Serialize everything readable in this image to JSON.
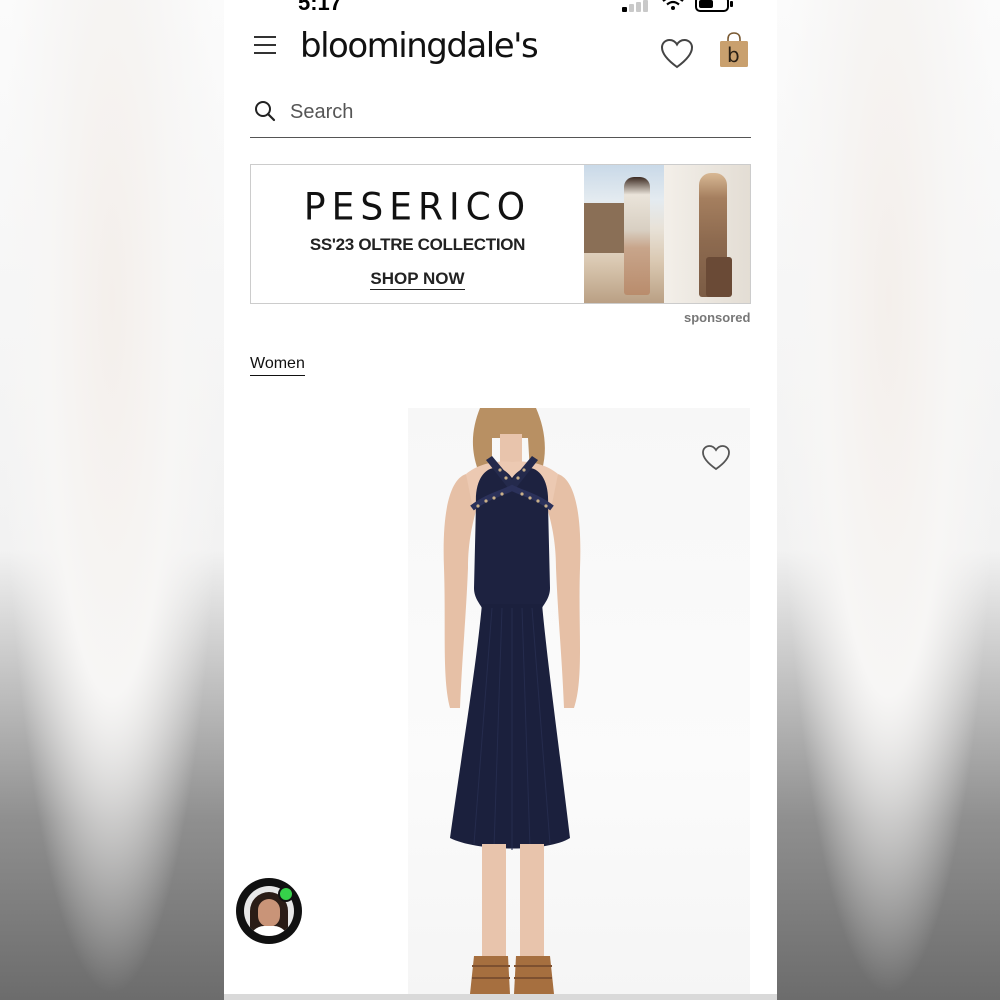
{
  "status_bar": {
    "time": "5:17"
  },
  "header": {
    "logo": "bloomingdale's",
    "bag_letter": "b"
  },
  "search": {
    "placeholder": "Search"
  },
  "banner": {
    "brand": "PESERICO",
    "subtitle": "SS'23 OLTRE COLLECTION",
    "cta": "SHOP NOW",
    "sponsored_label": "sponsored"
  },
  "breadcrumb": {
    "label": "Women"
  },
  "colors": {
    "dress": "#1d2240",
    "bag": "#c9a06e",
    "online": "#36d14a"
  },
  "icons": [
    "menu-icon",
    "heart-icon",
    "shopping-bag-icon",
    "search-icon",
    "chat-avatar"
  ]
}
